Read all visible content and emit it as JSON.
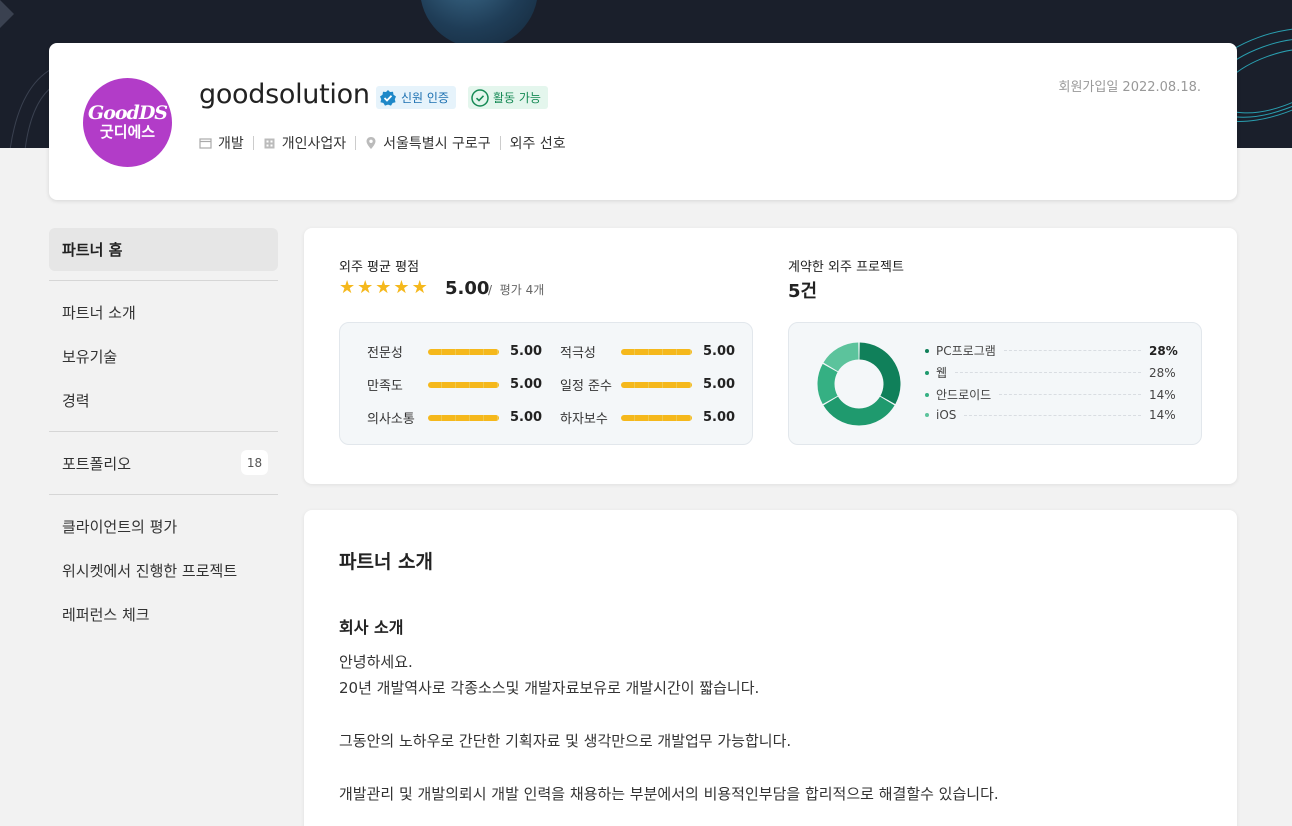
{
  "profile": {
    "name": "goodsolution",
    "logo_line1": "GoodDS",
    "logo_line2": "굿디에스",
    "badge_verify": "신원 인증",
    "badge_active": "활동 가능",
    "meta": {
      "field": "개발",
      "business_type": "개인사업자",
      "location": "서울특별시 구로구",
      "preference": "외주 선호"
    },
    "joined": "회원가입일 2022.08.18."
  },
  "sidebar": {
    "home": "파트너 홈",
    "group1": [
      "파트너 소개",
      "보유기술",
      "경력"
    ],
    "portfolio_label": "포트폴리오",
    "portfolio_count": "18",
    "group3": [
      "클라이언트의 평가",
      "위시켓에서 진행한 프로젝트",
      "레퍼런스 체크"
    ]
  },
  "rating": {
    "label": "외주 평균 평점",
    "average": "5.00",
    "review_count": "평가 4개",
    "stars": 5,
    "scores": [
      {
        "label": "전문성",
        "value": "5.00"
      },
      {
        "label": "적극성",
        "value": "5.00"
      },
      {
        "label": "만족도",
        "value": "5.00"
      },
      {
        "label": "일정 준수",
        "value": "5.00"
      },
      {
        "label": "의사소통",
        "value": "5.00"
      },
      {
        "label": "하자보수",
        "value": "5.00"
      }
    ]
  },
  "projects": {
    "label": "계약한 외주 프로젝트",
    "count": "5건",
    "breakdown": [
      {
        "name": "PC프로그램",
        "pct": "28%",
        "value": 28,
        "color": "#10805a"
      },
      {
        "name": "웹",
        "pct": "28%",
        "value": 28,
        "color": "#1f9a6e"
      },
      {
        "name": "안드로이드",
        "pct": "14%",
        "value": 14,
        "color": "#35b083"
      },
      {
        "name": "iOS",
        "pct": "14%",
        "value": 14,
        "color": "#5cc39c"
      }
    ]
  },
  "intro": {
    "title": "파트너 소개",
    "subtitle": "회사 소개",
    "lines": [
      "안녕하세요.",
      "20년 개발역사로 각종소스및 개발자료보유로 개발시간이 짧습니다.",
      "그동안의 노하우로 간단한 기획자료 및 생각만으로 개발업무 가능합니다.",
      "개발관리 및 개발의뢰시 개발 인력을 채용하는 부분에서의 비용적인부담을 합리적으로 해결할수 있습니다."
    ]
  }
}
